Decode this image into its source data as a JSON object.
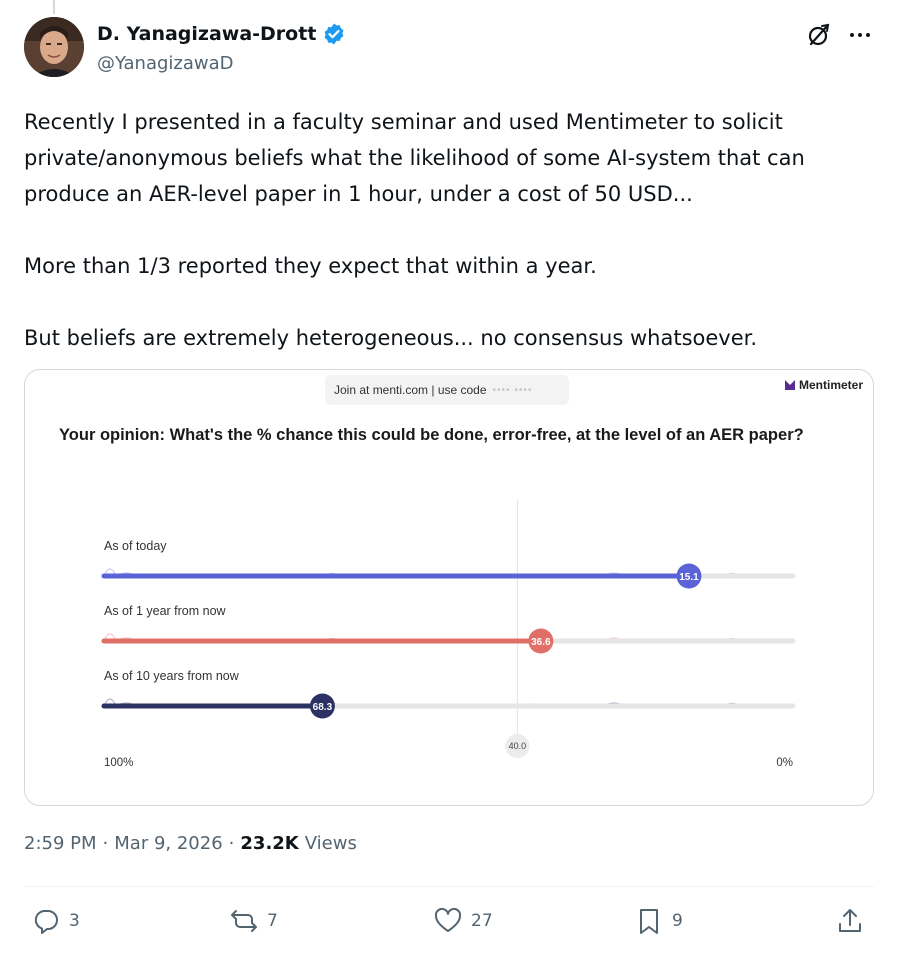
{
  "author": {
    "display_name": "D. Yanagizawa-Drott",
    "handle": "@YanagizawaD",
    "verified": true,
    "avatar_icon": "avatar-photo"
  },
  "header_icons": [
    "grok-icon",
    "more-icon"
  ],
  "tweet": {
    "paragraphs": [
      "Recently I presented in a faculty seminar and used Mentimeter to solicit private/anonymous beliefs what the likelihood of some AI-system that can produce an AER-level paper in 1 hour, under a cost of 50 USD...",
      "More than 1/3 reported they expect that within a year.",
      "But beliefs are extremely heterogeneous... no consensus whatsoever."
    ]
  },
  "media": {
    "join_text": "Join at menti.com | use code",
    "code_mask": "•••• ••••",
    "brand": "Mentimeter",
    "question": "Your opinion: What's the % chance this could be done, error-free, at the level of an AER paper?",
    "left_label": "100%",
    "right_label": "0%",
    "reference_label": "40.0",
    "colors": {
      "today": "#5b64d6",
      "one_year": "#e07067",
      "ten_years": "#2b3163",
      "track": "#e6e6e6"
    }
  },
  "chart_data": {
    "type": "scale",
    "x_range": [
      100,
      0
    ],
    "reference_value": 40.0,
    "series": [
      {
        "name": "As of today",
        "value": 15.1
      },
      {
        "name": "As of 1 year from now",
        "value": 36.6
      },
      {
        "name": "As of 10 years from now",
        "value": 68.3
      }
    ]
  },
  "footer": {
    "time": "2:59 PM",
    "date": "Mar 9, 2026",
    "views_count": "23.2K",
    "views_label": "Views"
  },
  "actions": {
    "replies": "3",
    "reposts": "7",
    "likes": "27",
    "bookmarks": "9"
  }
}
